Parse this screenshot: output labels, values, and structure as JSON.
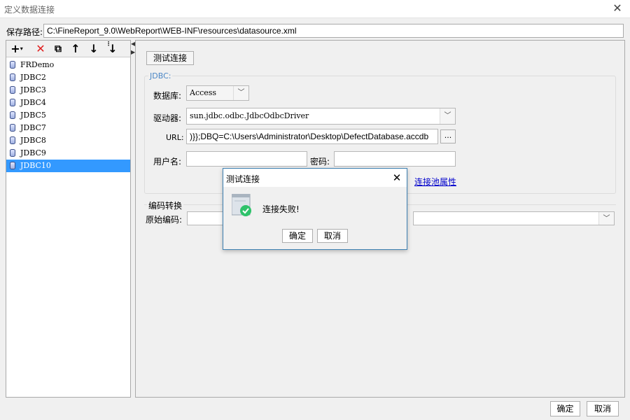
{
  "window": {
    "title": "定义数据连接"
  },
  "path": {
    "label": "保存路径:",
    "value": "C:\\FineReport_9.0\\WebReport\\WEB-INF\\resources\\datasource.xml"
  },
  "toolbar": {
    "add": "+",
    "add_caret": "▾",
    "delete": "✕",
    "copy": "⧉",
    "up": "↑",
    "down": "↓",
    "sort": "↓"
  },
  "tree": {
    "items": [
      "FRDemo",
      "JDBC2",
      "JDBC3",
      "JDBC4",
      "JDBC5",
      "JDBC7",
      "JDBC8",
      "JDBC9",
      "JDBC10"
    ],
    "selected": "JDBC10"
  },
  "form": {
    "test_button": "测试连接",
    "jdbc_legend": "JDBC:",
    "db_label": "数据库:",
    "db_value": "Access",
    "driver_label": "驱动器:",
    "driver_value": "sun.jdbc.odbc.JdbcOdbcDriver",
    "url_label": "URL:",
    "url_value": ")}};DBQ=C:\\Users\\Administrator\\Desktop\\DefectDatabase.accdb",
    "more_button": "...",
    "user_label": "用户名:",
    "user_value": "",
    "pwd_label": "密码:",
    "pwd_value": "",
    "pool_link": "连接池属性",
    "encoding_legend": "编码转换",
    "orig_enc_label": "原始编码:"
  },
  "footer": {
    "ok": "确定",
    "cancel": "取消"
  },
  "dialog": {
    "title": "测试连接",
    "message": "连接失败!",
    "ok": "确定",
    "cancel": "取消"
  },
  "colors": {
    "selection": "#3399ff",
    "link": "#0000cc",
    "success_icon": "#2ec26a",
    "legend": "#4a86c5"
  }
}
